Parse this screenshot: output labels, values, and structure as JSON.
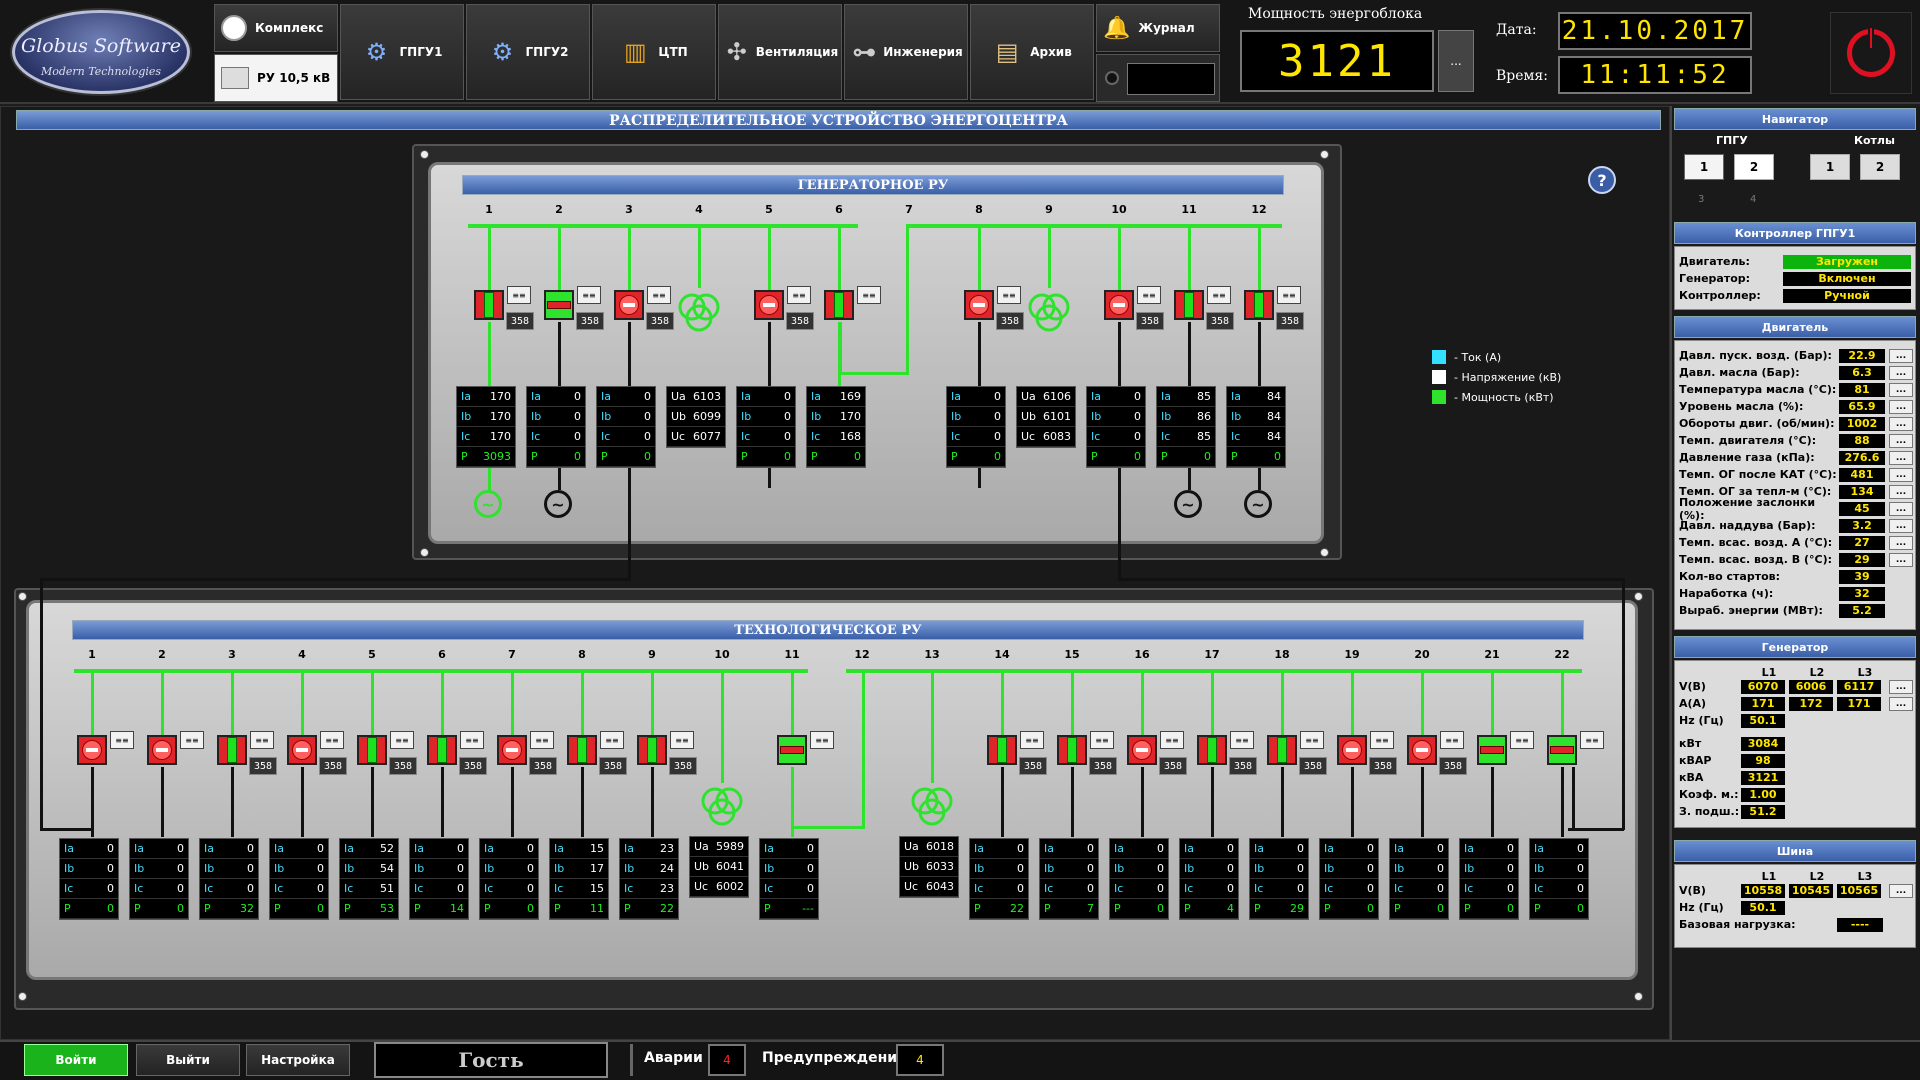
{
  "app": {
    "logo_line1": "Globus Software",
    "logo_line2": "Modern Technologies"
  },
  "topnav": {
    "kompleks": "Комплекс",
    "ru": "РУ 10,5 кВ",
    "gpgu1": "ГПГУ1",
    "gpgu2": "ГПГУ2",
    "ctp": "ЦТП",
    "vent": "Вентиляция",
    "eng": "Инженерия",
    "archive": "Архив",
    "journal": "Журнал",
    "power_label": "Мощность энергоблока",
    "power_value": "3121",
    "power_btn": "...",
    "date_label": "Дата:",
    "date_value": "21.10.2017",
    "time_label": "Время:",
    "time_value": "11:11:52"
  },
  "main_title": "РАСПРЕДЕЛИТЕЛЬНОЕ УСТРОЙСТВО ЭНЕРГОЦЕНТРА",
  "gen_ru": {
    "title": "ГЕНЕРАТОРНОЕ РУ",
    "cols": [
      "1",
      "2",
      "3",
      "4",
      "5",
      "6",
      "7",
      "8",
      "9",
      "10",
      "11",
      "12"
    ],
    "cells": [
      {
        "col": 1,
        "type": "i",
        "ia": "170",
        "ib": "170",
        "ic": "170",
        "p": "3093",
        "meter": "358"
      },
      {
        "col": 2,
        "type": "i",
        "ia": "0",
        "ib": "0",
        "ic": "0",
        "p": "0",
        "meter": "358"
      },
      {
        "col": 3,
        "type": "i",
        "ia": "0",
        "ib": "0",
        "ic": "0",
        "p": "0",
        "meter": "358"
      },
      {
        "col": 4,
        "type": "u",
        "ua": "6103",
        "ub": "6099",
        "uc": "6077"
      },
      {
        "col": 5,
        "type": "i",
        "ia": "0",
        "ib": "0",
        "ic": "0",
        "p": "0",
        "meter": "358"
      },
      {
        "col": 6,
        "type": "i",
        "ia": "169",
        "ib": "170",
        "ic": "168",
        "p": "0"
      },
      {
        "col": 8,
        "type": "i",
        "ia": "0",
        "ib": "0",
        "ic": "0",
        "p": "0",
        "meter": "358"
      },
      {
        "col": 9,
        "type": "u",
        "ua": "6106",
        "ub": "6101",
        "uc": "6083"
      },
      {
        "col": 10,
        "type": "i",
        "ia": "0",
        "ib": "0",
        "ic": "0",
        "p": "0",
        "meter": "358"
      },
      {
        "col": 11,
        "type": "i",
        "ia": "85",
        "ib": "86",
        "ic": "85",
        "p": "0",
        "meter": "358"
      },
      {
        "col": 12,
        "type": "i",
        "ia": "84",
        "ib": "84",
        "ic": "84",
        "p": "0",
        "meter": "358"
      }
    ]
  },
  "tech_ru": {
    "title": "ТЕХНОЛОГИЧЕСКОЕ РУ",
    "cols": [
      "1",
      "2",
      "3",
      "4",
      "5",
      "6",
      "7",
      "8",
      "9",
      "10",
      "11",
      "12",
      "13",
      "14",
      "15",
      "16",
      "17",
      "18",
      "19",
      "20",
      "21",
      "22"
    ],
    "cells": [
      {
        "col": 1,
        "ia": "0",
        "ib": "0",
        "ic": "0",
        "p": "0"
      },
      {
        "col": 2,
        "ia": "0",
        "ib": "0",
        "ic": "0",
        "p": "0"
      },
      {
        "col": 3,
        "ia": "0",
        "ib": "0",
        "ic": "0",
        "p": "32",
        "meter": "358"
      },
      {
        "col": 4,
        "ia": "0",
        "ib": "0",
        "ic": "0",
        "p": "0",
        "meter": "358"
      },
      {
        "col": 5,
        "ia": "52",
        "ib": "54",
        "ic": "51",
        "p": "53",
        "meter": "358"
      },
      {
        "col": 6,
        "ia": "0",
        "ib": "0",
        "ic": "0",
        "p": "14",
        "meter": "358"
      },
      {
        "col": 7,
        "ia": "0",
        "ib": "0",
        "ic": "0",
        "p": "0",
        "meter": "358"
      },
      {
        "col": 8,
        "ia": "15",
        "ib": "17",
        "ic": "15",
        "p": "11",
        "meter": "358"
      },
      {
        "col": 9,
        "ia": "23",
        "ib": "24",
        "ic": "23",
        "p": "22",
        "meter": "358"
      },
      {
        "col": 10,
        "type": "u",
        "ua": "5989",
        "ub": "6041",
        "uc": "6002"
      },
      {
        "col": 11,
        "ia": "0",
        "ib": "0",
        "ic": "0",
        "p": "---"
      },
      {
        "col": 13,
        "type": "u",
        "ua": "6018",
        "ub": "6033",
        "uc": "6043"
      },
      {
        "col": 14,
        "ia": "0",
        "ib": "0",
        "ic": "0",
        "p": "22",
        "meter": "358"
      },
      {
        "col": 15,
        "ia": "0",
        "ib": "0",
        "ic": "0",
        "p": "7",
        "meter": "358"
      },
      {
        "col": 16,
        "ia": "0",
        "ib": "0",
        "ic": "0",
        "p": "0",
        "meter": "358"
      },
      {
        "col": 17,
        "ia": "0",
        "ib": "0",
        "ic": "0",
        "p": "4",
        "meter": "358"
      },
      {
        "col": 18,
        "ia": "0",
        "ib": "0",
        "ic": "0",
        "p": "29",
        "meter": "358"
      },
      {
        "col": 19,
        "ia": "0",
        "ib": "0",
        "ic": "0",
        "p": "0",
        "meter": "358"
      },
      {
        "col": 20,
        "ia": "0",
        "ib": "0",
        "ic": "0",
        "p": "0",
        "meter": "358"
      },
      {
        "col": 21,
        "ia": "0",
        "ib": "0",
        "ic": "0",
        "p": "0"
      },
      {
        "col": 22,
        "ia": "0",
        "ib": "0",
        "ic": "0",
        "p": "0"
      }
    ]
  },
  "labels": {
    "ia": "Ia",
    "ib": "Ib",
    "ic": "Ic",
    "p": "P",
    "ua": "Ua",
    "ub": "Ub",
    "uc": "Uc"
  },
  "legend": {
    "current": "- Ток (А)",
    "voltage": "- Напряжение (кВ)",
    "power": "- Мощность (кВт)",
    "current_color": "#33e0ff",
    "voltage_color": "#ffffff",
    "power_color": "#2ee22e"
  },
  "help": "?",
  "right": {
    "nav_title": "Навигатор",
    "gpgu_label": "ГПГУ",
    "boilers_label": "Котлы",
    "gpgu_btns": [
      "1",
      "2"
    ],
    "gpgu_btns_hidden": [
      "3",
      "4"
    ],
    "boiler_btns": [
      "1",
      "2"
    ],
    "ctrl_title": "Контроллер ГПГУ1",
    "ctrl": [
      {
        "k": "Двигатель:",
        "v": "Загружен",
        "c": "#0db30d"
      },
      {
        "k": "Генератор:",
        "v": "Включен",
        "c": "#000000"
      },
      {
        "k": "Контроллер:",
        "v": "Ручной",
        "c": "#000000"
      }
    ],
    "engine_title": "Двигатель",
    "engine": [
      {
        "k": "Давл. пуск. возд. (Бар):",
        "v": "22.9"
      },
      {
        "k": "Давл. масла (Бар):",
        "v": "6.3"
      },
      {
        "k": "Температура масла (°C):",
        "v": "81"
      },
      {
        "k": "Уровень масла (%):",
        "v": "65.9"
      },
      {
        "k": "Обороты двиг. (об/мин):",
        "v": "1002"
      },
      {
        "k": "Темп. двигателя (°C):",
        "v": "88"
      },
      {
        "k": "Давление газа (кПа):",
        "v": "276.6"
      },
      {
        "k": "Темп. ОГ после КАТ (°C):",
        "v": "481"
      },
      {
        "k": "Темп. ОГ за тепл-м (°C):",
        "v": "134"
      },
      {
        "k": "Положение заслонки (%):",
        "v": "45"
      },
      {
        "k": "Давл. наддува (Бар):",
        "v": "3.2"
      },
      {
        "k": "Темп. всас. возд. А (°C):",
        "v": "27"
      },
      {
        "k": "Темп. всас. возд. В (°C):",
        "v": "29"
      },
      {
        "k": "Кол-во стартов:",
        "v": "39"
      },
      {
        "k": "Наработка (ч):",
        "v": "32"
      },
      {
        "k": "Выраб. энергии (МВт):",
        "v": "5.2"
      }
    ],
    "more": "...",
    "gen_title": "Генератор",
    "phase_heads": [
      "L1",
      "L2",
      "L3"
    ],
    "gen_v_label": "V(В)",
    "gen_v": [
      "6070",
      "6006",
      "6117"
    ],
    "gen_a_label": "А(А)",
    "gen_a": [
      "171",
      "172",
      "171"
    ],
    "gen_hz_label": "Hz (Гц)",
    "gen_hz": "50.1",
    "gen_extra": [
      {
        "k": "кВт",
        "v": "3084"
      },
      {
        "k": "кВАР",
        "v": "98"
      },
      {
        "k": "кВА",
        "v": "3121"
      },
      {
        "k": "Коэф. м.:",
        "v": "1.00"
      },
      {
        "k": "З. подш.:",
        "v": "51.2"
      }
    ],
    "bus_title": "Шина",
    "bus_v_label": "V(В)",
    "bus_v": [
      "10558",
      "10545",
      "10565"
    ],
    "bus_hz_label": "Hz (Гц)",
    "bus_hz": "50.1",
    "base_label": "Базовая нагрузка:",
    "base_value": "----"
  },
  "bottom": {
    "login": "Войти",
    "logout": "Выйти",
    "settings": "Настройка",
    "user": "Гость",
    "alarms_label": "Аварии",
    "alarms_value": "4",
    "warnings_label": "Предупреждения",
    "warnings_value": "4"
  }
}
